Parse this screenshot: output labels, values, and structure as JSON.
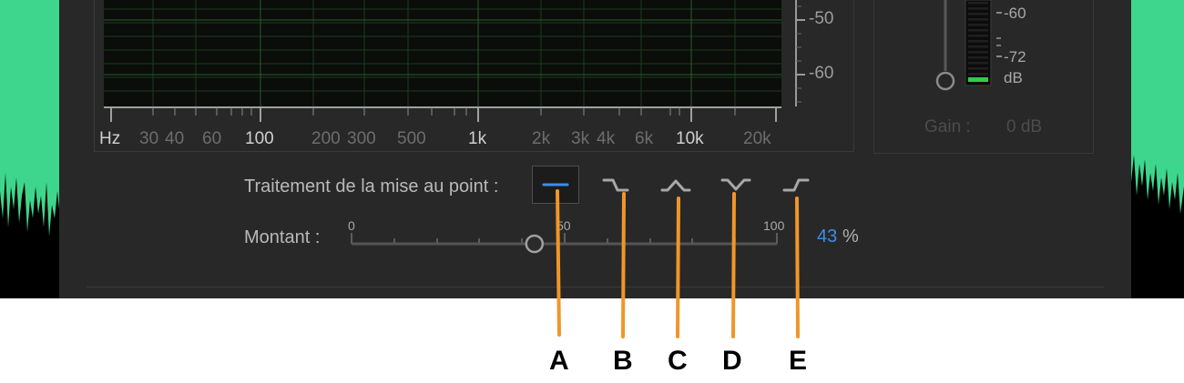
{
  "spectrum": {
    "y_labels": [
      "-50",
      "-60"
    ],
    "x_labels": [
      {
        "text": "Hz",
        "major": true
      },
      {
        "text": "30",
        "major": false
      },
      {
        "text": "40",
        "major": false
      },
      {
        "text": "60",
        "major": false
      },
      {
        "text": "100",
        "major": true
      },
      {
        "text": "200",
        "major": false
      },
      {
        "text": "300",
        "major": false
      },
      {
        "text": "500",
        "major": false
      },
      {
        "text": "1k",
        "major": true
      },
      {
        "text": "2k",
        "major": false
      },
      {
        "text": "3k",
        "major": false
      },
      {
        "text": "4k",
        "major": false
      },
      {
        "text": "6k",
        "major": false
      },
      {
        "text": "10k",
        "major": true
      },
      {
        "text": "20k",
        "major": false
      }
    ]
  },
  "meter": {
    "labels": [
      "-60",
      "-72",
      "dB"
    ],
    "gain_label": "Gain :",
    "gain_value": "0 dB"
  },
  "focus": {
    "label": "Traitement de la mise au point :",
    "options": [
      {
        "icon": "flat-icon",
        "selected": true
      },
      {
        "icon": "high-cut-icon",
        "selected": false
      },
      {
        "icon": "peak-icon",
        "selected": false
      },
      {
        "icon": "notch-icon",
        "selected": false
      },
      {
        "icon": "low-cut-icon",
        "selected": false
      }
    ]
  },
  "amount": {
    "label": "Montant :",
    "scale_min": "0",
    "scale_mid": "50",
    "scale_max": "100",
    "value": 43,
    "value_text": "43",
    "unit": "%"
  },
  "callouts": [
    "A",
    "B",
    "C",
    "D",
    "E"
  ],
  "colors": {
    "accent": "#3d8ee8",
    "callout_line": "#f0962a",
    "background_green": "#3ed68d",
    "panel": "#282828",
    "meter_green": "#33cc44"
  }
}
